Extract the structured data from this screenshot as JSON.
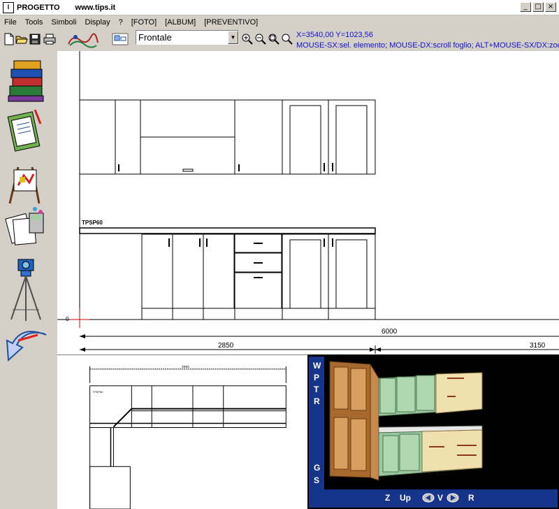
{
  "titlebar": {
    "app_name": "PROGETTO",
    "url": "www.tips.it",
    "icon_label": "Ⅰ"
  },
  "window_buttons": {
    "minimize": "_",
    "maximize": "□",
    "close": "×"
  },
  "menu": [
    "File",
    "Tools",
    "Simboli",
    "Display",
    "?",
    "[FOTO]",
    "[ALBUM]",
    "[PREVENTIVO]"
  ],
  "toolbar": {
    "view_select": "Frontale",
    "coords": "X=3540,00    Y=1023,56",
    "hint": "MOUSE-SX:sel. elemento; MOUSE-DX:scroll foglio; ALT+MOUSE-SX/DX:zoom;"
  },
  "drawing": {
    "label_top": "TPSP60",
    "origin_label": "0",
    "dim_total": "6000",
    "dim_left": "2850",
    "dim_right": "3150"
  },
  "plan": {
    "dim_label": "2850",
    "label": "TPSP60"
  },
  "view3d": {
    "side_buttons": [
      "W",
      "P",
      "T",
      "R",
      "G",
      "S"
    ],
    "bottom_buttons": [
      "Z",
      "Up",
      "V",
      "R"
    ],
    "colors": {
      "panel_blue": "#16358a",
      "wood_tall": "#a86a2c",
      "cabinet_green": "#9cc8a0",
      "cabinet_cream": "#f0e0b0"
    }
  }
}
